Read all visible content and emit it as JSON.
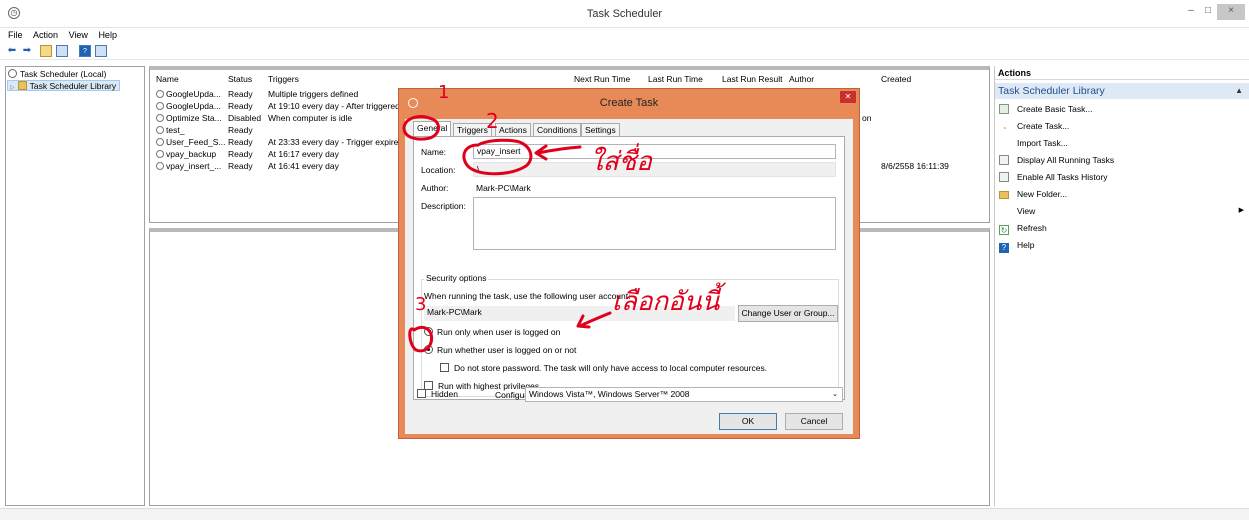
{
  "window": {
    "title": "Task Scheduler",
    "min": "–",
    "max": "□",
    "close": "×"
  },
  "menu": [
    "File",
    "Action",
    "View",
    "Help"
  ],
  "tree": {
    "root": "Task Scheduler (Local)",
    "library": "Task Scheduler Library"
  },
  "tasklist": {
    "headers": [
      "Name",
      "Status",
      "Triggers",
      "Next Run Time",
      "Last Run Time",
      "Last Run Result",
      "Author",
      "Created"
    ],
    "rows": [
      {
        "name": "GoogleUpda...",
        "status": "Ready",
        "triggers": "Multiple triggers defined",
        "created": ""
      },
      {
        "name": "GoogleUpda...",
        "status": "Ready",
        "triggers": "At 19:10 every day - After triggered",
        "created": ""
      },
      {
        "name": "Optimize Sta...",
        "status": "Disabled",
        "triggers": "When computer is idle",
        "created": ""
      },
      {
        "name": "test_",
        "status": "Ready",
        "triggers": "",
        "created": ""
      },
      {
        "name": "User_Feed_S...",
        "status": "Ready",
        "triggers": "At 23:33 every day - Trigger expires",
        "created": ""
      },
      {
        "name": "vpay_backup",
        "status": "Ready",
        "triggers": "At 16:17 every day",
        "created": ""
      },
      {
        "name": "vpay_insert_...",
        "status": "Ready",
        "triggers": "At 16:41 every day",
        "created": "8/6/2558 16:11:39"
      }
    ],
    "partial_text": "on"
  },
  "actions": {
    "header": "Actions",
    "library": "Task Scheduler Library",
    "items": [
      {
        "label": "Create Basic Task...",
        "icon": "wizard-icon"
      },
      {
        "label": "Create Task...",
        "icon": "task-icon"
      },
      {
        "label": "Import Task...",
        "icon": ""
      },
      {
        "label": "Display All Running Tasks",
        "icon": "list-icon"
      },
      {
        "label": "Enable All Tasks History",
        "icon": "history-icon"
      },
      {
        "label": "New Folder...",
        "icon": "folder-icon"
      },
      {
        "label": "View",
        "icon": "",
        "submenu": "▶"
      },
      {
        "label": "Refresh",
        "icon": "refresh-icon"
      },
      {
        "label": "Help",
        "icon": "help-icon"
      }
    ]
  },
  "dialog": {
    "title": "Create Task",
    "tabs": [
      "General",
      "Triggers",
      "Actions",
      "Conditions",
      "Settings"
    ],
    "name_label": "Name:",
    "name_value": "vpay_insert",
    "location_label": "Location:",
    "location_value": "\\",
    "author_label": "Author:",
    "author_value": "Mark-PC\\Mark",
    "description_label": "Description:",
    "description_value": "",
    "security_title": "Security options",
    "security_prompt": "When running the task, use the following user account:",
    "user_account": "Mark-PC\\Mark",
    "change_user_button": "Change User or Group...",
    "radio_logged_on": "Run only when user is logged on",
    "radio_whether": "Run whether user is logged on or not",
    "no_store_password": "Do not store password.  The task will only have access to local computer resources.",
    "highest_privileges": "Run with highest privileges",
    "hidden_label": "Hidden",
    "configure_label": "Configure for:",
    "configure_value": "Windows Vista™, Windows Server™ 2008",
    "ok_button": "OK",
    "cancel_button": "Cancel"
  },
  "annotations": {
    "color": "#e0001b",
    "num1": "1",
    "num2": "2",
    "num3": "3",
    "note_name": "ใส่ชื่อ",
    "note_select": "เลือกอันนี้"
  }
}
